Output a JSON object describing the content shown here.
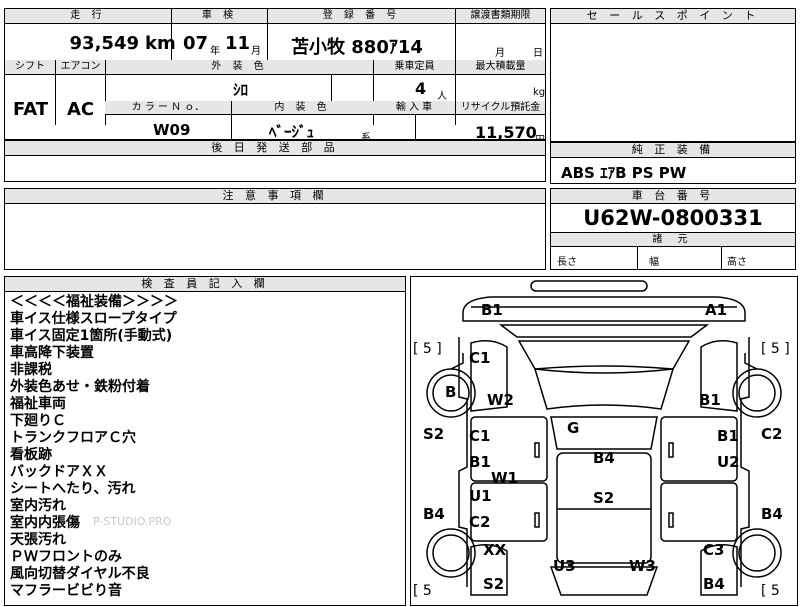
{
  "top": {
    "mileage_label": "走 行",
    "mileage_value": "93,549",
    "mileage_unit": "km",
    "inspection_label": "車 検",
    "inspection_year": "07",
    "inspection_year_unit": "年",
    "inspection_month": "11",
    "inspection_month_unit": "月",
    "registration_label": "登 録 番 号",
    "registration_value": "苫小牧 880ｱ14",
    "transfer_label": "譲渡書類期限",
    "transfer_month_unit": "月",
    "transfer_day_unit": "日"
  },
  "mid": {
    "shift_label": "シフト",
    "shift_value": "FAT",
    "ac_label": "エアコン",
    "ac_value": "AC",
    "exterior_label": "外 装 色",
    "exterior_value": "ｼﾛ",
    "capacity_label": "乗車定員",
    "capacity_value": "4",
    "capacity_unit": "人",
    "maxload_label": "最大積載量",
    "maxload_unit": "kg",
    "colorno_label": "カ ラ ー Ｎ ｏ．",
    "colorno_value": "W09",
    "interior_label": "内 装 色",
    "interior_value": "ﾍﾞｰｼﾞｭ",
    "interior_unit": "系",
    "import_label": "輸 入 車",
    "recycle_label": "リサイクル預託金",
    "recycle_value": "11,570",
    "recycle_unit": "円"
  },
  "later_parts_label": "後 日 発 送 部 品",
  "caution_label": "注 意 事 項 欄",
  "sales_point_label": "セ ー ル ス ポ イ ン ト",
  "equipment": {
    "label": "純 正 装 備",
    "value": "ABS  ｴｱB  PS  PW"
  },
  "chassis": {
    "label": "車 台 番 号",
    "value": "U62W-0800331"
  },
  "dimensions": {
    "label": "諸 元",
    "length_label": "長さ",
    "width_label": "幅",
    "height_label": "高さ"
  },
  "inspector": {
    "label": "検 査 員 記 入 欄",
    "notes": [
      "＜＜＜＜福祉装備＞＞＞＞",
      "車イス仕様スロープタイプ",
      "車イス固定1箇所(手動式)",
      "車高降下装置",
      "非課税",
      "外装色あせ・鉄粉付着",
      "福祉車両",
      "下廻りＣ",
      "トランクフロアＣ穴",
      "看板跡",
      "バックドアＸＸ",
      "シートへたり、汚れ",
      "室内汚れ",
      "室内内張傷",
      "天張汚れ",
      "ＰＷフロントのみ",
      "風向切替ダイヤル不良",
      "マフラービビり音"
    ],
    "watermark": "P-STUDIO.PRO"
  },
  "diagram": {
    "tire_tl": "[ 5 ]",
    "tire_tr": "[ 5 ]",
    "tire_bl": "[ 5",
    "tire_br": "[ 5",
    "marks": {
      "b1_top": "B1",
      "a1_top": "A1",
      "c1_front": "C1",
      "b_wheel": "B",
      "w2": "W2",
      "b1_right_front": "B1",
      "s2_left": "S2",
      "c1_left": "C1",
      "g": "G",
      "b1_right": "B1",
      "c2_right": "C2",
      "b1_left": "B1",
      "b4_roof": "B4",
      "u2": "U2",
      "w1": "W1",
      "u1": "U1",
      "s2_roof": "S2",
      "b4_left": "B4",
      "c2_left": "C2",
      "b4_right": "B4",
      "xx": "XX",
      "c3": "C3",
      "u3": "U3",
      "w3": "W3",
      "s2_rear": "S2",
      "b4_rear": "B4"
    }
  }
}
